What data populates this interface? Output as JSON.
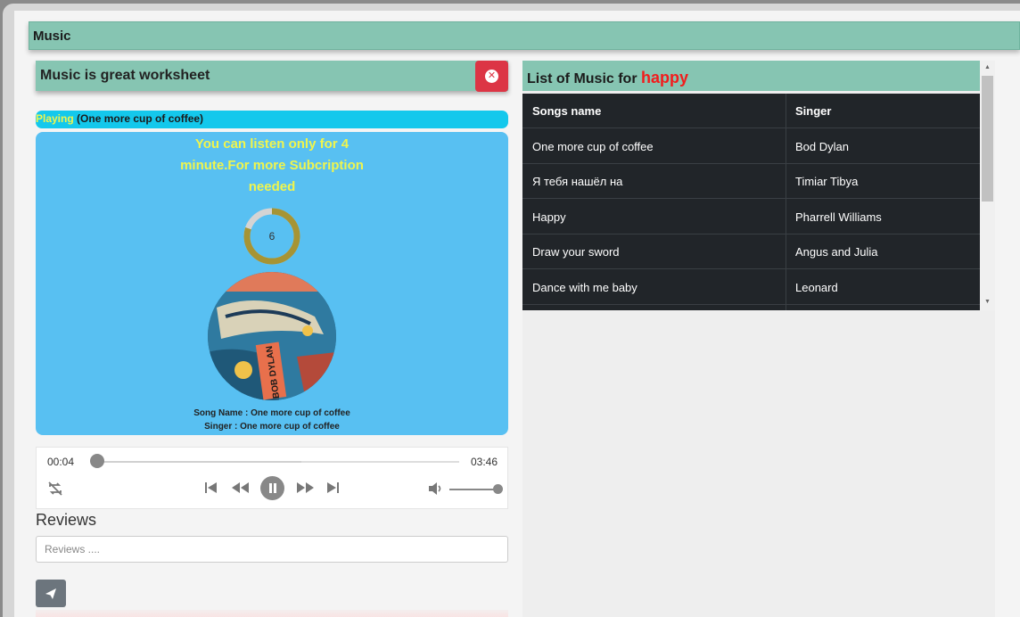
{
  "app": {
    "title": "Music"
  },
  "worksheet": {
    "title": "Music is great worksheet"
  },
  "now_playing": {
    "label": "Playing",
    "song": "(One more cup of coffee)"
  },
  "player": {
    "notice": "You can listen only for 4 minute.For more Subcription needed",
    "countdown": "6",
    "countdown_progress": 0.8,
    "song_name": "Song Name : One more cup of coffee",
    "singer": "Singer : One more cup of coffee",
    "cover_text": "BOB DYLAN"
  },
  "audio": {
    "current_time": "00:04",
    "duration": "03:46",
    "progress": 0.018,
    "buffered": 0.57,
    "volume": 1.0
  },
  "reviews": {
    "title": "Reviews",
    "placeholder": "Reviews ...."
  },
  "music_list": {
    "title_prefix": "List of Music for",
    "mood": "happy",
    "columns": [
      "Songs name",
      "Singer"
    ],
    "rows": [
      {
        "song": "One more cup of coffee",
        "singer": "Bod Dylan"
      },
      {
        "song": "Я тебя нашёл на",
        "singer": "Timiar Tibya"
      },
      {
        "song": "Happy",
        "singer": "Pharrell Williams"
      },
      {
        "song": "Draw your sword",
        "singer": "Angus and Julia"
      },
      {
        "song": "Dance with me baby",
        "singer": "Leonard"
      }
    ]
  },
  "colors": {
    "header_green": "#86c5b2",
    "danger": "#dc3545",
    "player_blue": "#58c0f2",
    "playing_cyan": "#14c8ec",
    "notice_yellow": "#f0f54d",
    "mood_red": "#f21c1c",
    "table_dark": "#212529"
  }
}
